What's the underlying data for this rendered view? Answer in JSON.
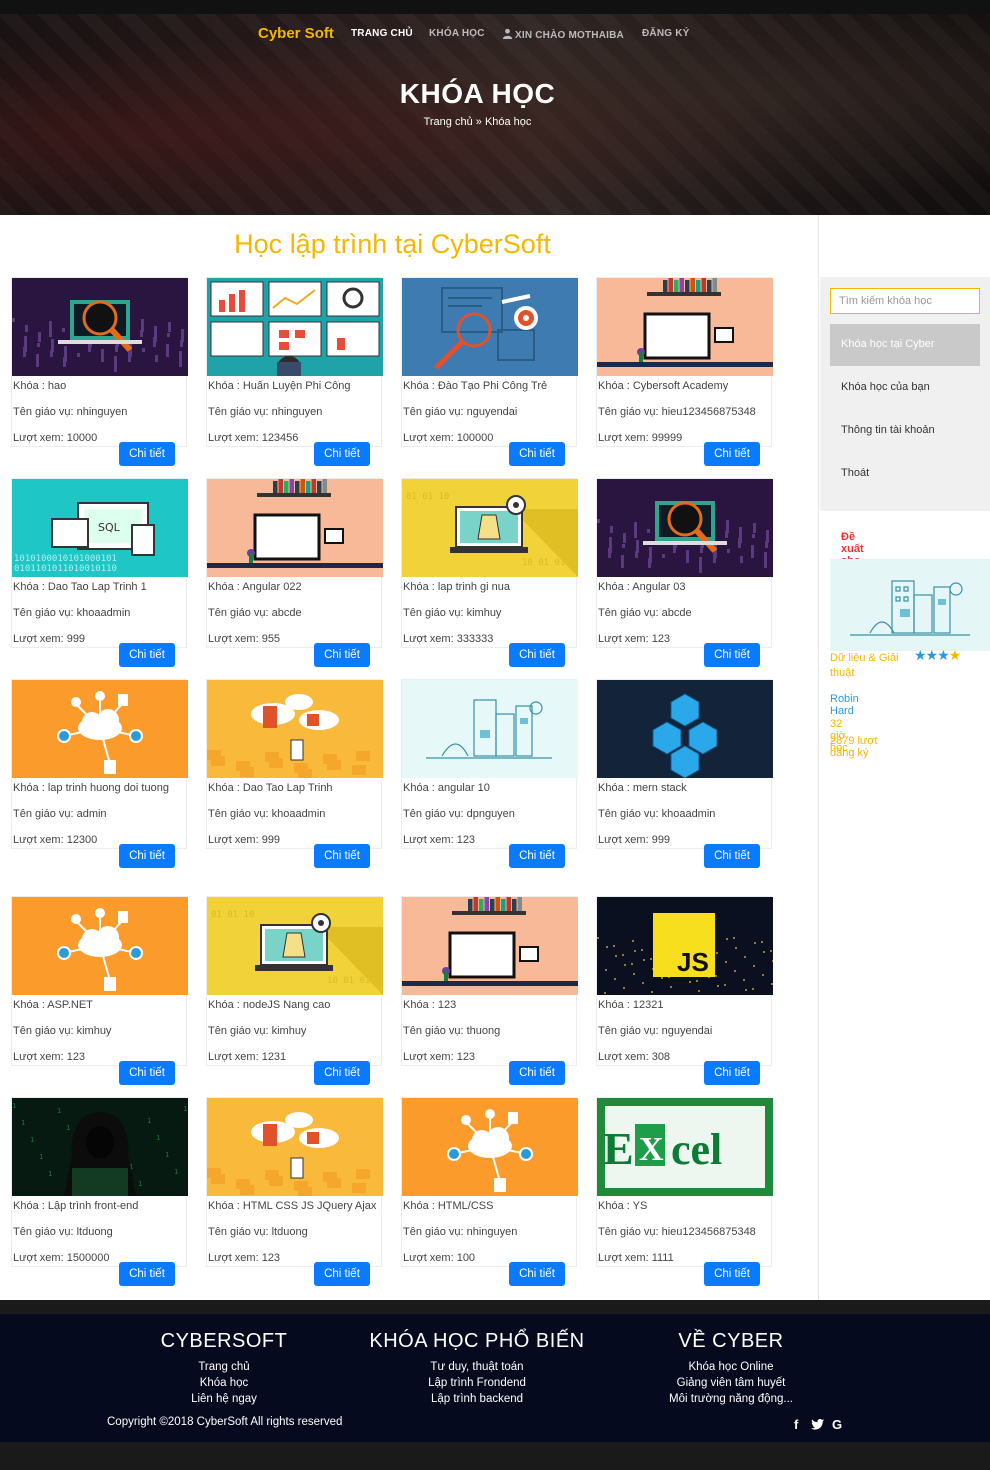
{
  "nav": {
    "brand": "Cyber Soft",
    "items": [
      "TRANG CHỦ",
      "KHÓA HỌC",
      "XIN CHÀO MOTHAIBA",
      "ĐĂNG KÝ"
    ]
  },
  "hero": {
    "title": "KHÓA HỌC",
    "breadcrumb_home": "Trang chủ",
    "breadcrumb_sep": "»",
    "breadcrumb_current": "Khóa học"
  },
  "main": {
    "heading": "Học lập trình tại CyberSoft",
    "detail_label": "Chi tiết"
  },
  "courses": [
    {
      "name": "Khóa : hao",
      "teacher": "Tên giáo vụ: nhinguyen",
      "views": "Lượt xem: 10000",
      "thumb": "code-dark"
    },
    {
      "name": "Khóa : Huấn Luyện Phi Công",
      "teacher": "Tên giáo vụ: nhinguyen",
      "views": "Lượt xem: 123456",
      "thumb": "dashboards"
    },
    {
      "name": "Khóa : Đào Tạo Phi Công Trẻ",
      "teacher": "Tên giáo vụ: nguyendai",
      "views": "Lượt xem: 100000",
      "thumb": "analytics-blue"
    },
    {
      "name": "Khóa : Cybersoft Academy",
      "teacher": "Tên giáo vụ: hieu123456875348",
      "views": "Lượt xem: 99999",
      "thumb": "desk-peach"
    },
    {
      "name": "Khóa : Dao Tao Lap Trinh 1",
      "teacher": "Tên giáo vụ: khoaadmin",
      "views": "Lượt xem: 999",
      "thumb": "devices-teal"
    },
    {
      "name": "Khóa : Angular 022",
      "teacher": "Tên giáo vụ: abcde",
      "views": "Lượt xem: 955",
      "thumb": "desk-peach"
    },
    {
      "name": "Khóa : lap trinh gi nua",
      "teacher": "Tên giáo vụ: kimhuy",
      "views": "Lượt xem: 333333",
      "thumb": "laptop-yellow"
    },
    {
      "name": "Khóa : Angular 03",
      "teacher": "Tên giáo vụ: abcde",
      "views": "Lượt xem: 123",
      "thumb": "code-dark"
    },
    {
      "name": "Khóa : lap trinh huong doi tuong",
      "teacher": "Tên giáo vụ: admin",
      "views": "Lượt xem: 12300",
      "thumb": "cloud-orange"
    },
    {
      "name": "Khóa : Dao Tao Lap Trinh",
      "teacher": "Tên giáo vụ: khoaadmin",
      "views": "Lượt xem: 999",
      "thumb": "cloud-boxes"
    },
    {
      "name": "Khóa : angular 10",
      "teacher": "Tên giáo vụ: dpnguyen",
      "views": "Lượt xem: 123",
      "thumb": "city-mint"
    },
    {
      "name": "Khóa : mern stack",
      "teacher": "Tên giáo vụ: khoaadmin",
      "views": "Lượt xem: 999",
      "thumb": "cubes-navy"
    },
    {
      "name": "Khóa : ASP.NET",
      "teacher": "Tên giáo vụ: kimhuy",
      "views": "Lượt xem: 123",
      "thumb": "cloud-orange"
    },
    {
      "name": "Khóa : nodeJS Nang cao",
      "teacher": "Tên giáo vụ: kimhuy",
      "views": "Lượt xem: 1231",
      "thumb": "laptop-yellow"
    },
    {
      "name": "Khóa : 123",
      "teacher": "Tên giáo vụ: thuong",
      "views": "Lượt xem: 123",
      "thumb": "desk-peach"
    },
    {
      "name": "Khóa : 12321",
      "teacher": "Tên giáo vụ: nguyendai",
      "views": "Lượt xem: 308",
      "thumb": "js-city"
    },
    {
      "name": "Khóa : Lập trình front-end",
      "teacher": "Tên giáo vụ: ltduong",
      "views": "Lượt xem: 1500000",
      "thumb": "hacker"
    },
    {
      "name": "Khóa : HTML CSS JS JQuery Ajax",
      "teacher": "Tên giáo vụ: ltduong",
      "views": "Lượt xem: 123",
      "thumb": "cloud-boxes"
    },
    {
      "name": "Khóa : HTML/CSS",
      "teacher": "Tên giáo vụ: nhinguyen",
      "views": "Lượt xem: 100",
      "thumb": "cloud-orange"
    },
    {
      "name": "Khóa : YS",
      "teacher": "Tên giáo vụ: hieu123456875348",
      "views": "Lượt xem: 1111",
      "thumb": "excel"
    }
  ],
  "sidebar": {
    "search_placeholder": "Tìm kiếm khóa học",
    "menu": [
      "Khóa học tại Cyber",
      "Khóa học của bạn",
      "Thông tin tài khoản",
      "Thoát"
    ],
    "selected_index": 0,
    "suggest_title": "Đề xuất cho bạn",
    "suggest": {
      "category": "Dữ liệu & Giải thuật",
      "rating": 4,
      "author": "Robin Hard",
      "hours": "32 giờ học",
      "registered": "2879 lượt đăng ký"
    }
  },
  "footer": {
    "cols": [
      {
        "title": "CYBERSOFT",
        "links": [
          "Trang chủ",
          "Khóa học",
          "Liên hệ ngay"
        ]
      },
      {
        "title": "KHÓA HỌC PHỔ BIẾN",
        "links": [
          "Tư duy, thuật toán",
          "Lập trình Frondend",
          "Lập trình backend"
        ]
      },
      {
        "title": "VỀ CYBER",
        "links": [
          "Khóa học Online",
          "Giảng viên tâm huyết",
          "Môi trường năng động..."
        ]
      }
    ],
    "copyright": "Copyright ©2018 CyberSoft All rights reserved",
    "social": [
      "facebook-icon",
      "twitter-icon",
      "google-icon"
    ]
  },
  "colors": {
    "accent": "#f5b800",
    "button": "#0a7bff",
    "footer_bg": "#050a1e",
    "suggest_title": "#e33333",
    "link_blue": "#2a9bd8"
  }
}
